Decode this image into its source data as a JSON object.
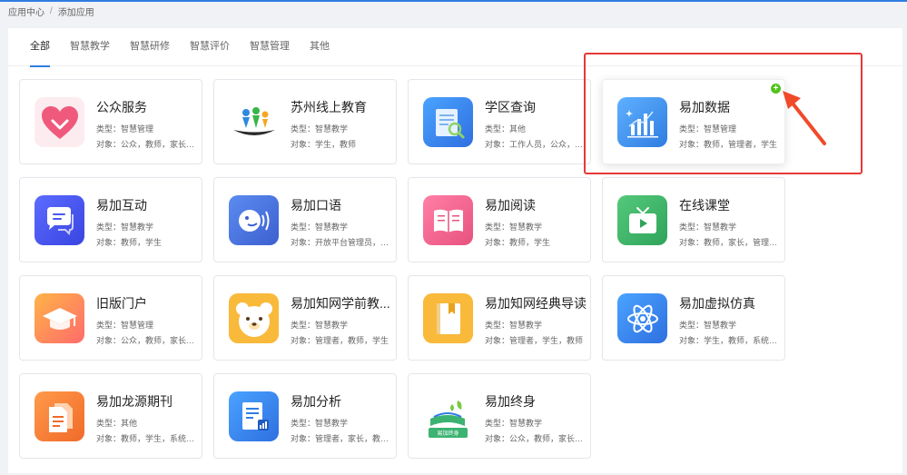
{
  "breadcrumb": {
    "home": "应用中心",
    "separator": "/",
    "current": "添加应用"
  },
  "tabs": [
    "全部",
    "智慧教学",
    "智慧研修",
    "智慧评价",
    "智慧管理",
    "其他"
  ],
  "accent": "#2f7de1",
  "highlight_color": "#e53935",
  "apps": [
    {
      "name": "公众服务",
      "type": "类型：智慧管理",
      "target": "对象：公众，教师，家长，...",
      "icon": "heart-icon"
    },
    {
      "name": "苏州线上教育",
      "type": "类型：智慧教学",
      "target": "对象：学生，教师",
      "icon": "boat-people-icon"
    },
    {
      "name": "学区查询",
      "type": "类型：其他",
      "target": "对象：工作人员，公众，教...",
      "icon": "document-search-icon"
    },
    {
      "name": "易加数据",
      "type": "类型：智慧管理",
      "target": "对象：教师，管理者，学生",
      "icon": "bar-chart-icon",
      "badge": "+"
    },
    {
      "name": "易加互动",
      "type": "类型：智慧教学",
      "target": "对象：教师，学生",
      "icon": "chat-bubbles-icon"
    },
    {
      "name": "易加口语",
      "type": "类型：智慧教学",
      "target": "对象：开放平台管理员，教...",
      "icon": "speaking-face-icon"
    },
    {
      "name": "易加阅读",
      "type": "类型：智慧教学",
      "target": "对象：教师，学生",
      "icon": "open-book-icon"
    },
    {
      "name": "在线课堂",
      "type": "类型：智慧教学",
      "target": "对象：教师，家长，管理者...",
      "icon": "tv-play-icon"
    },
    {
      "name": "旧版门户",
      "type": "类型：智慧管理",
      "target": "对象：公众，教师，家长，...",
      "icon": "graduation-cap-icon"
    },
    {
      "name": "易加知网学前教...",
      "type": "类型：智慧教学",
      "target": "对象：管理者，教师，学生",
      "icon": "bear-icon"
    },
    {
      "name": "易加知网经典导读",
      "type": "类型：智慧教学",
      "target": "对象：管理者，学生，教师",
      "icon": "book-icon"
    },
    {
      "name": "易加虚拟仿真",
      "type": "类型：智慧教学",
      "target": "对象：学生，教师，系统管...",
      "icon": "atom-icon"
    },
    {
      "name": "易加龙源期刊",
      "type": "类型：其他",
      "target": "对象：教师，学生，系统管...",
      "icon": "files-icon"
    },
    {
      "name": "易加分析",
      "type": "类型：智慧教学",
      "target": "对象：管理者，家长，教师...",
      "icon": "report-chart-icon"
    },
    {
      "name": "易加终身",
      "type": "类型：智慧教学",
      "target": "对象：公众，教师，家长，...",
      "icon": "lifelong-learning-icon",
      "icon_label": "易加终身"
    }
  ]
}
